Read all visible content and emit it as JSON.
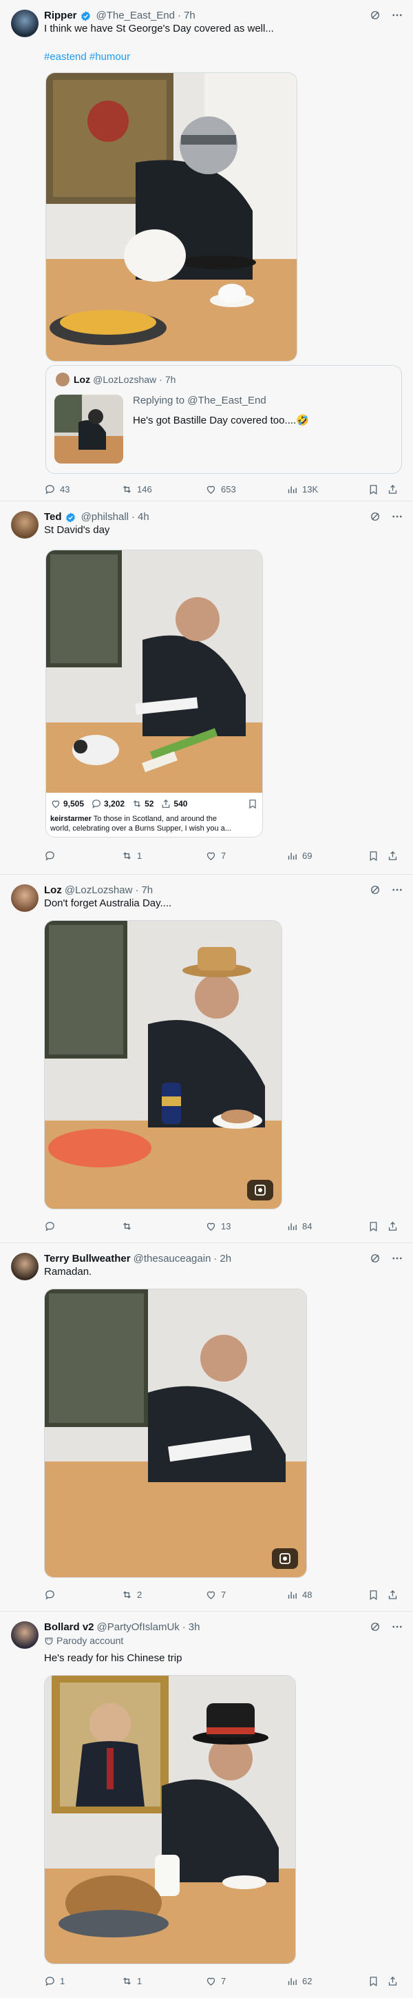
{
  "posts": [
    {
      "display_name": "Ripper",
      "handle": "@The_East_End",
      "time": "7h",
      "text": "I think we have St George's Day covered as well...",
      "hashtags": "#eastend #humour",
      "quote": {
        "display_name": "Loz",
        "handle": "@LozLozshaw",
        "time": "7h",
        "replying_to": "Replying to @The_East_End",
        "text": "He's got Bastille Day covered too....🤣"
      },
      "actions": {
        "replies": "43",
        "reposts": "146",
        "likes": "653",
        "views": "13K"
      }
    },
    {
      "display_name": "Ted",
      "handle": "@philshall",
      "time": "4h",
      "text": "St David's day",
      "embedded_insta": {
        "likes": "9,505",
        "comments": "3,202",
        "reposts": "52",
        "shares": "540",
        "caption_user": "keirstarmer",
        "caption_text": " To those in Scotland, and around the",
        "caption_text2": "world, celebrating over a Burns Supper, I wish you a..."
      },
      "actions": {
        "replies": "",
        "reposts": "1",
        "likes": "7",
        "views": "69"
      }
    },
    {
      "display_name": "Loz",
      "handle": "@LozLozshaw",
      "time": "7h",
      "text": "Don't forget Australia Day....",
      "actions": {
        "replies": "",
        "reposts": "",
        "likes": "13",
        "views": "84"
      }
    },
    {
      "display_name": "Terry Bullweather",
      "handle": "@thesauceagain",
      "time": "2h",
      "text": "Ramadan.",
      "actions": {
        "replies": "",
        "reposts": "2",
        "likes": "7",
        "views": "48"
      }
    },
    {
      "display_name": "Bollard v2",
      "handle": "@PartyOfIslamUk",
      "time": "3h",
      "parody_label": "Parody account",
      "text": "He's ready for his Chinese trip",
      "actions": {
        "replies": "1",
        "reposts": "1",
        "likes": "7",
        "views": "62"
      }
    }
  ],
  "colors": {
    "accent": "#1d9bf0",
    "muted": "#536471",
    "text": "#0f1419",
    "background": "#f7f7f7"
  },
  "icons": [
    "verified-icon",
    "grok-icon",
    "more-icon",
    "reply-icon",
    "repost-icon",
    "like-icon",
    "views-icon",
    "bookmark-icon",
    "share-icon",
    "parody-icon"
  ]
}
